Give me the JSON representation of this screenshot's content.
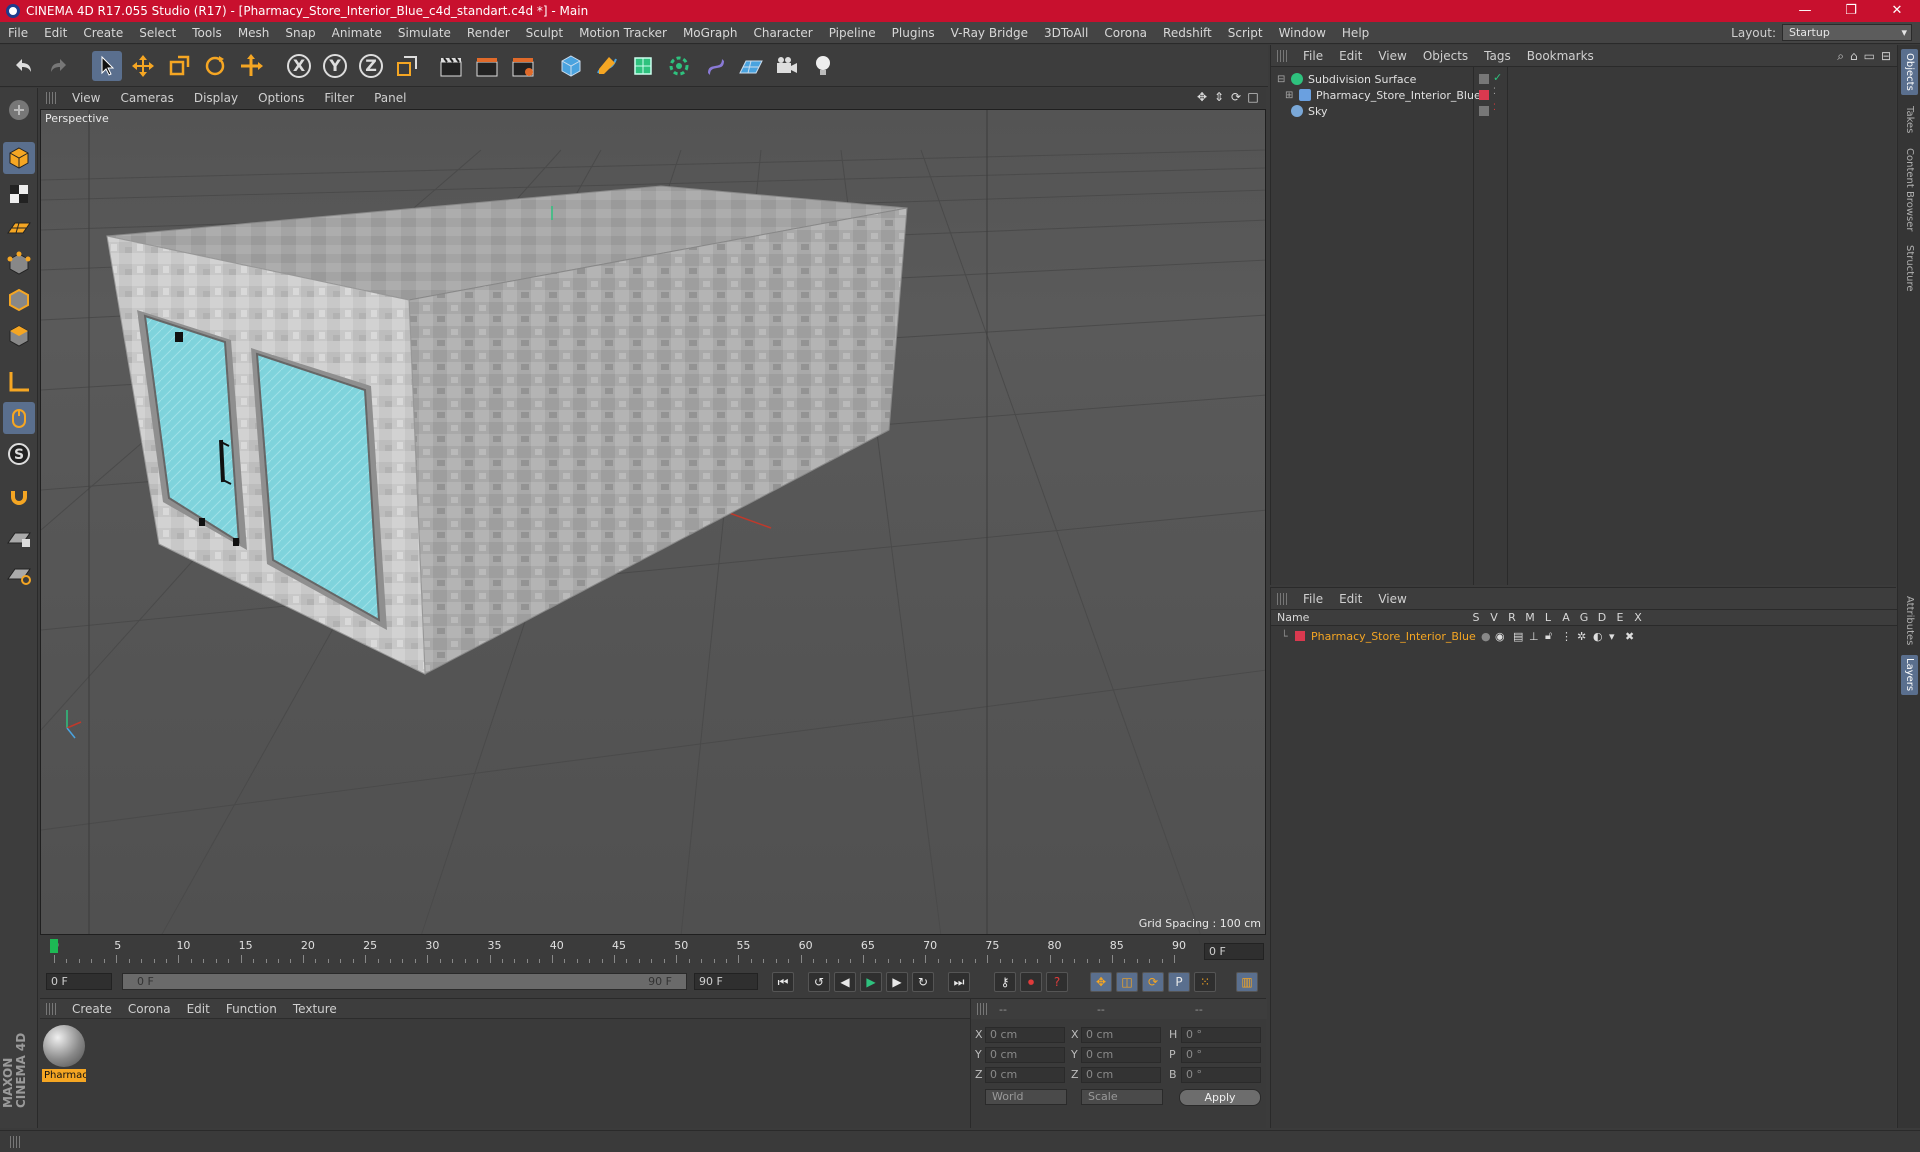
{
  "window": {
    "title": "CINEMA 4D R17.055 Studio (R17) - [Pharmacy_Store_Interior_Blue_c4d_standart.c4d *] - Main",
    "controls": [
      "—",
      "❐",
      "✕"
    ]
  },
  "menubar": {
    "items": [
      "File",
      "Edit",
      "Create",
      "Select",
      "Tools",
      "Mesh",
      "Snap",
      "Animate",
      "Simulate",
      "Render",
      "Sculpt",
      "Motion Tracker",
      "MoGraph",
      "Character",
      "Pipeline",
      "Plugins",
      "V-Ray Bridge",
      "3DToAll",
      "Corona",
      "Redshift",
      "Script",
      "Window",
      "Help"
    ],
    "layout_label": "Layout:",
    "layout_value": "Startup"
  },
  "toolbar": {
    "axis_x": "X",
    "axis_y": "Y",
    "axis_z": "Z"
  },
  "viewport": {
    "menu": [
      "View",
      "Cameras",
      "Display",
      "Options",
      "Filter",
      "Panel"
    ],
    "label": "Perspective",
    "grid_spacing": "Grid Spacing : 100 cm"
  },
  "timeline": {
    "labels": [
      "0",
      "5",
      "10",
      "15",
      "20",
      "25",
      "30",
      "35",
      "40",
      "45",
      "50",
      "55",
      "60",
      "65",
      "70",
      "75",
      "80",
      "85",
      "90"
    ],
    "current_frame": "0 F"
  },
  "transport": {
    "start_field": "0 F",
    "range_start": "0 F",
    "range_end": "90 F",
    "end_field": "90 F"
  },
  "material_panel": {
    "menu": [
      "Create",
      "Corona",
      "Edit",
      "Function",
      "Texture"
    ],
    "material_name": "Pharmac"
  },
  "coordinates": {
    "headers": [
      "--",
      "--",
      "--"
    ],
    "rows": [
      {
        "a": "X",
        "av": "0 cm",
        "b": "X",
        "bv": "0 cm",
        "c": "H",
        "cv": "0 °"
      },
      {
        "a": "Y",
        "av": "0 cm",
        "b": "Y",
        "bv": "0 cm",
        "c": "P",
        "cv": "0 °"
      },
      {
        "a": "Z",
        "av": "0 cm",
        "b": "Z",
        "bv": "0 cm",
        "c": "B",
        "cv": "0 °"
      }
    ],
    "mode_world": "World",
    "mode_scale": "Scale",
    "apply": "Apply"
  },
  "object_manager": {
    "menu": [
      "File",
      "Edit",
      "View",
      "Objects",
      "Tags",
      "Bookmarks"
    ],
    "objects": [
      {
        "name": "Subdivision Surface",
        "icon_color": "#2ec27e"
      },
      {
        "name": "Pharmacy_Store_Interior_Blue",
        "icon_color": "#6aa0e0"
      },
      {
        "name": "Sky",
        "icon_color": "#7aa8d8"
      }
    ]
  },
  "layer_manager": {
    "menu": [
      "File",
      "Edit",
      "View"
    ],
    "columns": [
      "Name",
      "S",
      "V",
      "R",
      "M",
      "L",
      "A",
      "G",
      "D",
      "E",
      "X"
    ],
    "layer_name": "Pharmacy_Store_Interior_Blue",
    "layer_color": "#d9394f"
  },
  "right_tabs": [
    "Objects",
    "Takes",
    "Content Browser",
    "Structure",
    "Attributes",
    "Layers"
  ],
  "branding": {
    "logo_text": "MAXON CINEMA 4D"
  },
  "colors": {
    "accent": "#5a6f8e",
    "title_bar": "#c8102e",
    "glass": "#7fd3dc",
    "layer_name": "#f5a623"
  }
}
